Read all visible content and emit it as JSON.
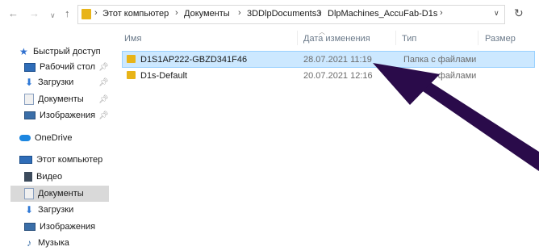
{
  "nav": {
    "back_icon": "arrow-left-icon",
    "forward_icon": "arrow-right-icon",
    "recent_icon": "chevron-down-icon",
    "up_icon": "arrow-up-icon"
  },
  "breadcrumb": {
    "items": [
      "Этот компьютер",
      "Документы",
      "3DDlpDocuments3",
      "DlpMachines_AccuFab-D1s"
    ]
  },
  "navpane": {
    "quick_access": "Быстрый доступ",
    "desktop": "Рабочий стол",
    "downloads": "Загрузки",
    "documents": "Документы",
    "pictures": "Изображения",
    "onedrive": "OneDrive",
    "this_pc": "Этот компьютер",
    "pc_video": "Видео",
    "pc_documents": "Документы",
    "pc_downloads": "Загрузки",
    "pc_pictures": "Изображения",
    "pc_music": "Музыка"
  },
  "columns": {
    "name": "Имя",
    "date": "Дата изменения",
    "type": "Тип",
    "size": "Размер"
  },
  "files": [
    {
      "name": "D1S1AP222-GBZD341F46",
      "date": "28.07.2021 11:19",
      "type": "Папка с файлами"
    },
    {
      "name": "D1s-Default",
      "date": "20.07.2021 12:16",
      "type": "Папка с файлами"
    }
  ],
  "colors": {
    "selection": "#cce8ff",
    "folder": "#e8b418",
    "arrow": "#2a0b4a"
  }
}
